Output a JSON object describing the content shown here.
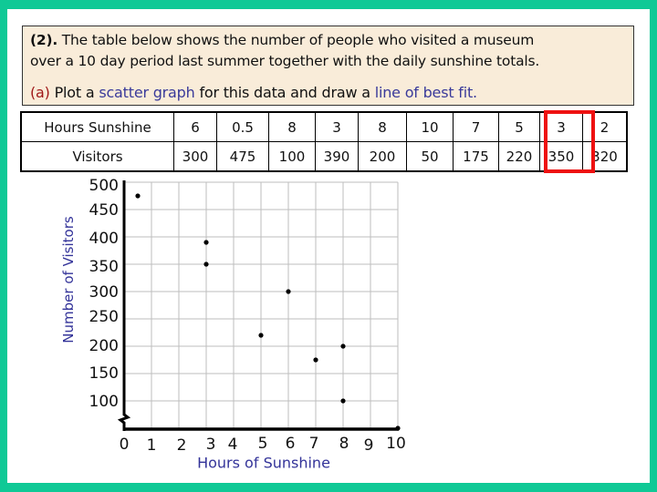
{
  "question": {
    "number": "(2).",
    "line1": " The table below shows the number of people who visited a museum",
    "line2": "over a 10 day period last summer together with the daily sunshine totals.",
    "part_label": "(a)",
    "part_text_1": " Plot a ",
    "part_hl_1": "scatter graph",
    "part_text_2": " for this data and draw a ",
    "part_hl_2": "line of best fit."
  },
  "table": {
    "row_headers": [
      "Hours Sunshine",
      "Visitors"
    ],
    "highlighted_column_index": 8,
    "highlight_color": "#ee1111"
  },
  "colors": {
    "frame": "#0fc996",
    "question_bg": "#f9ecd9",
    "axis_title": "#333399",
    "part_label": "#a01818",
    "keyword": "#3a3a9a",
    "grid": "#bdbdbd"
  },
  "chart_data": {
    "type": "scatter",
    "title": "",
    "xlabel": "Hours of Sunshine",
    "ylabel": "Number of Visitors",
    "xlim": [
      0,
      10
    ],
    "ylim": [
      50,
      500
    ],
    "y_axis_break": true,
    "grid": true,
    "x_ticks": [
      "0",
      "1",
      "2",
      "3",
      "4",
      "5",
      "6",
      "7",
      "8",
      "9",
      "10"
    ],
    "y_ticks": [
      "500",
      "450",
      "400",
      "350",
      "300",
      "250",
      "200",
      "150",
      "100"
    ],
    "table_x": [
      6,
      0.5,
      8,
      3,
      8,
      10,
      7,
      5,
      3,
      2
    ],
    "table_y": [
      300,
      475,
      100,
      390,
      200,
      50,
      175,
      220,
      350,
      320
    ],
    "plotted_points": [
      {
        "x": 0.5,
        "y": 475
      },
      {
        "x": 3,
        "y": 390
      },
      {
        "x": 3,
        "y": 350
      },
      {
        "x": 5,
        "y": 220
      },
      {
        "x": 6,
        "y": 300
      },
      {
        "x": 7,
        "y": 175
      },
      {
        "x": 8,
        "y": 200
      },
      {
        "x": 8,
        "y": 100
      },
      {
        "x": 10,
        "y": 50
      }
    ],
    "legend": null
  }
}
